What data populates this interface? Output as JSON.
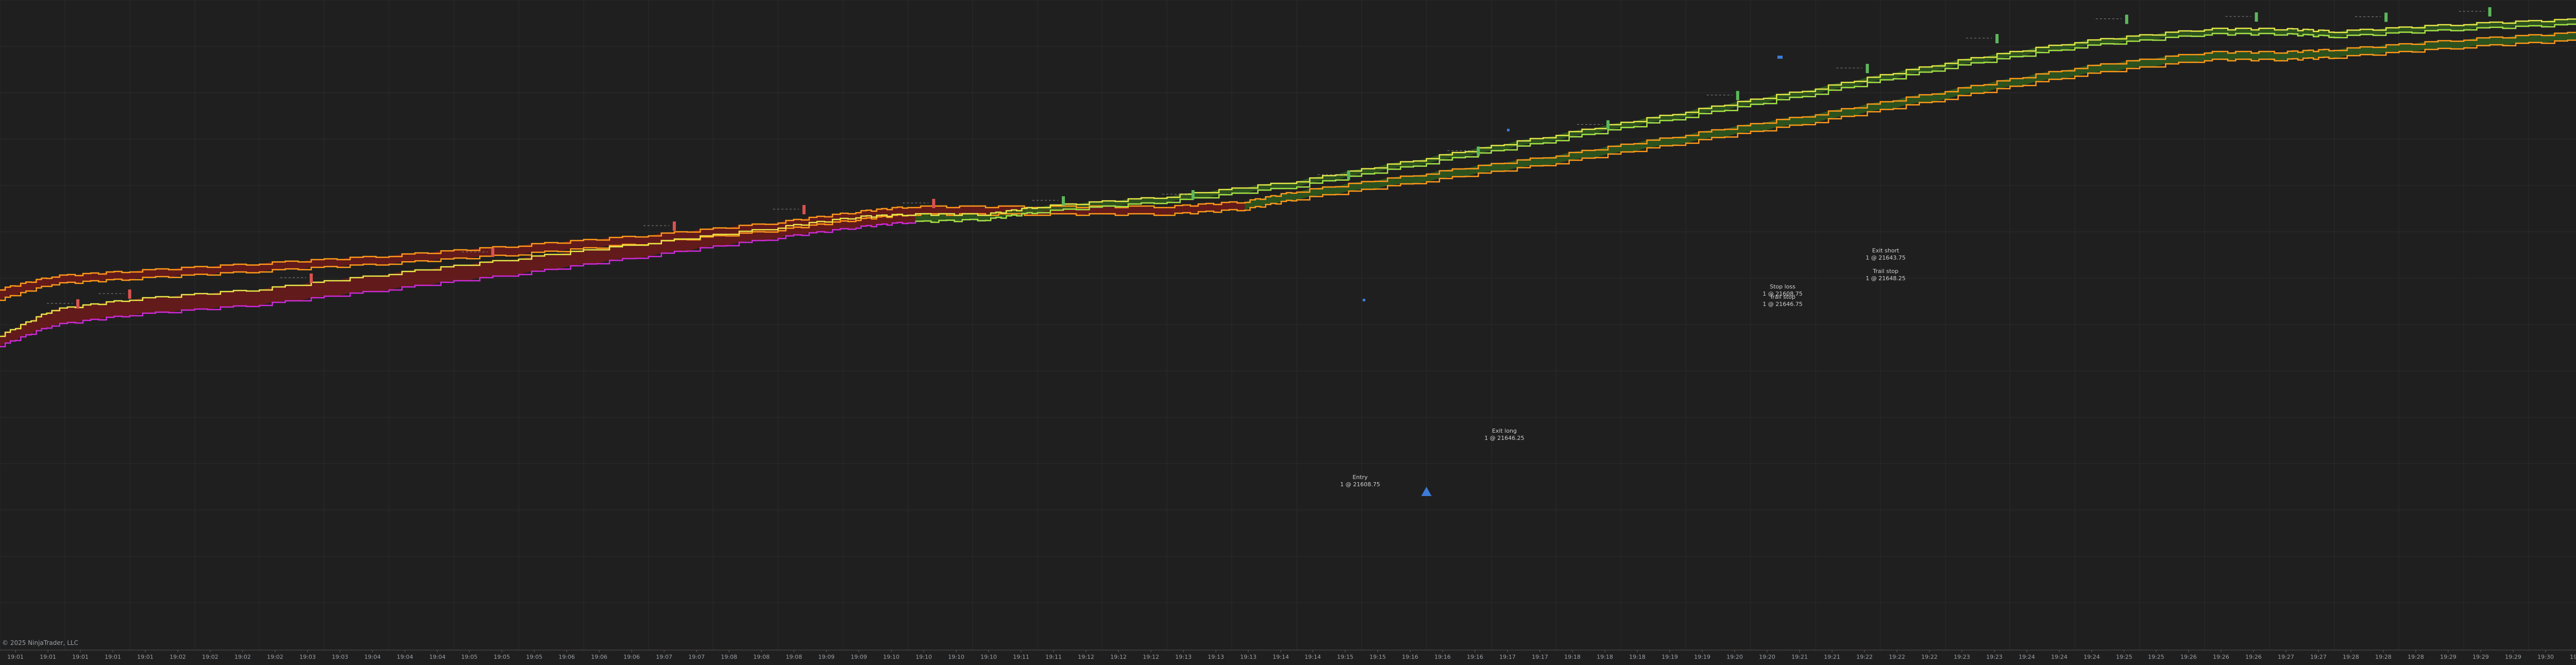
{
  "copyright": "© 2025 NinjaTrader, LLC",
  "colors": {
    "background": "#1f1f1f",
    "grid": "#2b2b2b",
    "bear_fill": "#7a1a1a",
    "bull_fill": "#2f5f1e",
    "yellow_line": "#e8e84a",
    "orange_line": "#ff9a1a",
    "magenta_line": "#d02ad8",
    "green_line": "#9be83a",
    "up_marker": "#5cb85c",
    "down_marker": "#d9534f",
    "accent_blue": "#3d7bd8",
    "axis_text": "#9aa0a6"
  },
  "chart_data": {
    "type": "line",
    "x_ticks": [
      "19:01",
      "19:01",
      "19:01",
      "19:01",
      "19:01",
      "19:02",
      "19:02",
      "19:02",
      "19:02",
      "19:03",
      "19:03",
      "19:04",
      "19:04",
      "19:04",
      "19:05",
      "19:05",
      "19:05",
      "19:06",
      "19:06",
      "19:06",
      "19:07",
      "19:07",
      "19:08",
      "19:08",
      "19:08",
      "19:09",
      "19:09",
      "19:10",
      "19:10",
      "19:10",
      "19:10",
      "19:11",
      "19:11",
      "19:12",
      "19:12",
      "19:12",
      "19:13",
      "19:13",
      "19:13",
      "19:14",
      "19:14",
      "19:15",
      "19:15",
      "19:16",
      "19:16",
      "19:16",
      "19:17",
      "19:17",
      "19:18",
      "19:18",
      "19:18",
      "19:19",
      "19:19",
      "19:20",
      "19:20",
      "19:21",
      "19:21",
      "19:22",
      "19:22",
      "19:22",
      "19:23",
      "19:23",
      "19:24",
      "19:24",
      "19:24",
      "19:25",
      "19:25",
      "19:26",
      "19:26",
      "19:26",
      "19:27",
      "19:27",
      "19:28",
      "19:28",
      "19:28",
      "19:29",
      "19:29",
      "19:29",
      "19:30",
      "19:30"
    ],
    "series": [
      {
        "role": "upper_band_top",
        "color": "#ff9a1a",
        "x": [
          0,
          2,
          5,
          10,
          15,
          20,
          25,
          30,
          33,
          35,
          40,
          45,
          48,
          50,
          55,
          60,
          65,
          70,
          75,
          80,
          85,
          88,
          90,
          95,
          100
        ],
        "y": [
          560,
          535,
          525,
          510,
          495,
          475,
          455,
          430,
          410,
          400,
          400,
          400,
          390,
          370,
          335,
          300,
          260,
          220,
          175,
          130,
          100,
          100,
          95,
          75,
          60
        ]
      },
      {
        "role": "upper_band_bottom",
        "color": "#ff9a1a",
        "x": [
          0,
          2,
          5,
          10,
          15,
          20,
          25,
          30,
          33,
          35,
          40,
          45,
          48,
          50,
          55,
          60,
          65,
          70,
          75,
          80,
          85,
          88,
          90,
          95,
          100
        ],
        "y": [
          580,
          550,
          540,
          525,
          510,
          492,
          470,
          445,
          425,
          415,
          415,
          415,
          405,
          385,
          350,
          315,
          275,
          235,
          190,
          145,
          115,
          115,
          110,
          90,
          75
        ]
      },
      {
        "role": "lower_band_top",
        "color": "#e8e84a",
        "x": [
          0,
          2,
          5,
          10,
          15,
          20,
          25,
          30,
          33,
          35,
          38,
          40,
          45,
          50,
          55,
          60,
          65,
          70,
          75,
          80,
          85,
          88,
          90,
          95,
          100
        ],
        "y": [
          650,
          600,
          580,
          560,
          530,
          500,
          470,
          440,
          420,
          415,
          415,
          400,
          380,
          350,
          305,
          260,
          215,
          170,
          120,
          80,
          55,
          55,
          60,
          45,
          35
        ]
      },
      {
        "role": "lower_band_bottom",
        "color": "#d02ad8",
        "x": [
          0,
          2,
          5,
          10,
          15,
          20,
          25,
          30,
          33,
          35,
          38,
          40,
          45,
          50,
          55,
          60,
          65,
          70,
          75,
          80,
          85,
          88,
          90,
          95,
          100
        ],
        "y": [
          670,
          630,
          610,
          590,
          560,
          530,
          495,
          460,
          440,
          430,
          425,
          410,
          390,
          360,
          315,
          270,
          225,
          180,
          130,
          90,
          65,
          65,
          70,
          55,
          45
        ]
      }
    ],
    "legend": "none",
    "grid": true
  },
  "annotations": [
    {
      "label": "Entry",
      "sub": "1 @ 21608.75"
    },
    {
      "label": "Exit long",
      "sub": "1 @ 21646.25"
    },
    {
      "label": "Stop loss",
      "sub": "1 @ 21608.75"
    },
    {
      "label": "Trail stop",
      "sub": "1 @ 21646.75"
    },
    {
      "label": "Exit short",
      "sub": "1 @ 21643.75"
    },
    {
      "label": "Trail stop",
      "sub": "1 @ 21648.25"
    }
  ]
}
